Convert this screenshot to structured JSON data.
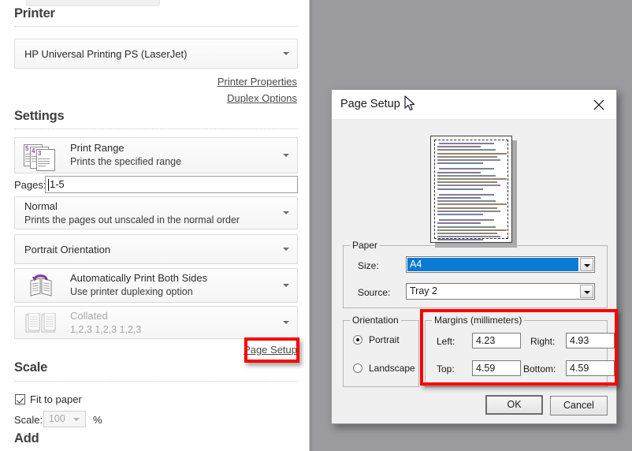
{
  "print_pane": {
    "printer_section": {
      "heading": "Printer",
      "selected_printer": "HP Universal Printing PS (LaserJet)",
      "links": [
        "Printer Properties",
        "Duplex Options"
      ]
    },
    "settings_section": {
      "heading": "Settings",
      "print_range": {
        "title": "Print Range",
        "subtitle": "Prints the specified range"
      },
      "pages_label": "Pages:",
      "pages_value": "1-5",
      "scaling": {
        "title": "Normal",
        "subtitle": "Prints the pages out unscaled in the normal order"
      },
      "orientation": {
        "title": "Portrait Orientation"
      },
      "duplex": {
        "title": "Automatically Print Both Sides",
        "subtitle": "Use printer duplexing option"
      },
      "collation": {
        "title": "Collated",
        "subtitle": "1,2,3 1,2,3 1,2,3"
      },
      "page_setup_link": "Page Setup",
      "page_icon_numbers": [
        "5",
        "4",
        "3"
      ]
    },
    "scale_section": {
      "heading": "Scale",
      "fit_to_paper_label": "Fit to paper",
      "fit_to_paper_checked": true,
      "scale_label": "Scale:",
      "scale_value": "100",
      "percent_symbol": "%"
    },
    "add_section": {
      "heading": "Add"
    }
  },
  "dialog": {
    "title": "Page Setup",
    "close_icon": "close-icon",
    "paper": {
      "legend": "Paper",
      "size_label": "Size:",
      "size_value": "A4",
      "source_label": "Source:",
      "source_value": "Tray 2"
    },
    "orientation": {
      "legend": "Orientation",
      "portrait_label": "Portrait",
      "landscape_label": "Landscape",
      "selected": "Portrait"
    },
    "margins": {
      "legend": "Margins (millimeters)",
      "left_label": "Left:",
      "left_value": "4.23",
      "right_label": "Right:",
      "right_value": "4.93",
      "top_label": "Top:",
      "top_value": "4.59",
      "bottom_label": "Bottom:",
      "bottom_value": "4.59"
    },
    "buttons": {
      "ok": "OK",
      "cancel": "Cancel"
    }
  },
  "highlights": {
    "color": "#fb0000"
  }
}
